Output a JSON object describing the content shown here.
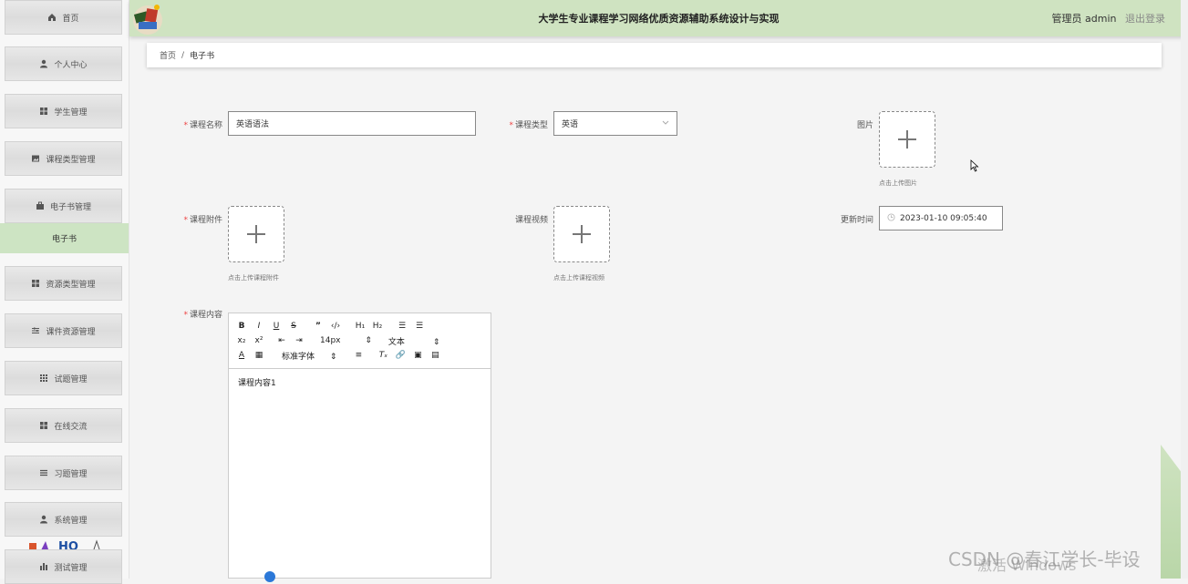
{
  "header": {
    "title": "大学生专业课程学习网络优质资源辅助系统设计与实现",
    "user_prefix": "管理员",
    "username": "admin",
    "logout": "退出登录",
    "bg_color": "#cfe3c1"
  },
  "sidebar": {
    "items": [
      {
        "label": "首页",
        "icon": "home-icon"
      },
      {
        "label": "个人中心",
        "icon": "user-icon"
      },
      {
        "label": "学生管理",
        "icon": "grid-icon"
      },
      {
        "label": "课程类型管理",
        "icon": "image-icon"
      },
      {
        "label": "电子书管理",
        "icon": "briefcase-icon"
      },
      {
        "label": "资源类型管理",
        "icon": "grid-icon"
      },
      {
        "label": "课件资源管理",
        "icon": "sliders-icon"
      },
      {
        "label": "试题管理",
        "icon": "apps-icon"
      },
      {
        "label": "在线交流",
        "icon": "grid-icon"
      },
      {
        "label": "习题管理",
        "icon": "list-icon"
      },
      {
        "label": "系统管理",
        "icon": "user-icon"
      },
      {
        "label": "测试管理",
        "icon": "chart-icon"
      }
    ],
    "active_sub": "电子书",
    "active_color": "#cde4c3"
  },
  "breadcrumb": {
    "home": "首页",
    "separator": "/",
    "current": "电子书"
  },
  "form": {
    "course_name": {
      "label": "课程名称",
      "value": "英语语法"
    },
    "course_type": {
      "label": "课程类型",
      "value": "英语"
    },
    "image": {
      "label": "图片",
      "hint": "点击上传图片"
    },
    "attachment": {
      "label": "课程附件",
      "hint": "点击上传课程附件"
    },
    "video": {
      "label": "课程视频",
      "hint": "点击上传课程视频"
    },
    "update_time": {
      "label": "更新时间",
      "value": "2023-01-10 09:05:40"
    },
    "content": {
      "label": "课程内容",
      "value": "课程内容1"
    }
  },
  "editor": {
    "font_size": "14px",
    "text_type": "文本",
    "font_family": "标准字体"
  },
  "watermark": "CSDN @春江学长-毕设",
  "activate_windows": "激活 Windows"
}
